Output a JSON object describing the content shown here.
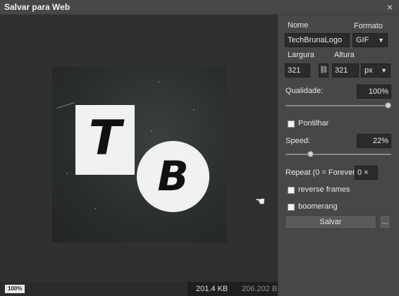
{
  "window": {
    "title": "Salvar para Web",
    "close_glyph": "×"
  },
  "preview": {
    "letter_t": "T",
    "letter_b": "B",
    "cursor_glyph": "☚"
  },
  "status": {
    "zoom": "100%",
    "size_kb": "201.4 KB",
    "size_b": "206.202 B"
  },
  "panel": {
    "name_label": "Nome",
    "name_value": "TechBrunaLogo",
    "format_label": "Formato",
    "format_value": "GIF",
    "width_label": "Largura",
    "width_value": "321",
    "height_label": "Altura",
    "height_value": "321",
    "link_glyph": "⛓",
    "unit_value": "px",
    "quality_label": "Qualidade:",
    "quality_value": "100%",
    "quality_level": 1.0,
    "dither_label": "Pontilhar",
    "speed_label": "Speed:",
    "speed_value": "22%",
    "speed_level": 0.22,
    "repeat_label": "Repeat (0 = Forever):",
    "repeat_value": "0 ×",
    "reverse_label": "reverse frames",
    "boomerang_label": "boomerang",
    "save_label": "Salvar",
    "more_label": "..."
  },
  "icons": {
    "close": "close-icon",
    "chain": "chain-link-icon",
    "hand": "hand-cursor-icon",
    "dropdown": "chevron-down-icon"
  }
}
